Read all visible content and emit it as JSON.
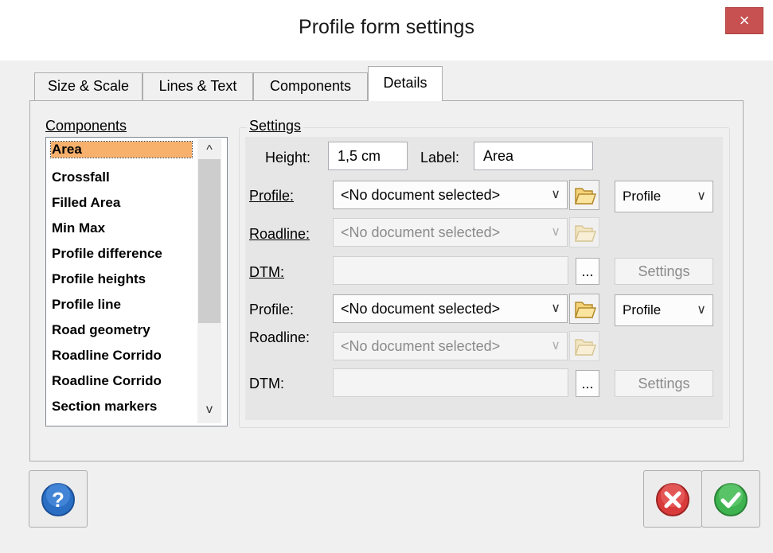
{
  "window": {
    "title": "Profile form settings",
    "close_glyph": "×"
  },
  "tabs": [
    {
      "label": "Size & Scale",
      "active": false
    },
    {
      "label": "Lines & Text",
      "active": false
    },
    {
      "label": "Components",
      "active": false
    },
    {
      "label": "Details",
      "active": true
    }
  ],
  "components": {
    "label": "Components",
    "items": [
      "Area",
      "Crossfall",
      "Filled Area",
      "Min Max",
      "Profile difference",
      "Profile heights",
      "Profile line",
      "Road geometry",
      "Roadline Corrido",
      "Roadline Corrido",
      "Section markers"
    ],
    "selected": "Area",
    "scroll_up_glyph": "^",
    "scroll_down_glyph": "v"
  },
  "settings": {
    "label": "Settings",
    "height_label": "Height:",
    "height_value": "1,5 cm",
    "label_label": "Label:",
    "label_value": "Area",
    "group1": {
      "profile_label": "Profile:",
      "profile_value": "<No document selected>",
      "profile_type": "Profile",
      "roadline_label": "Roadline:",
      "roadline_value": "<No document selected>",
      "dtm_label": "DTM:",
      "dtm_value": "",
      "ellipsis": "...",
      "settings_button": "Settings"
    },
    "group2": {
      "profile_label": "Profile:",
      "profile_value": "<No document selected>",
      "profile_type": "Profile",
      "roadline_label": "Roadline:",
      "roadline_value": "<No document selected>",
      "dtm_label": "DTM:",
      "dtm_value": "",
      "ellipsis": "...",
      "settings_button": "Settings"
    }
  },
  "icons": {
    "help": "help-icon",
    "cancel": "cancel-icon",
    "ok": "ok-icon",
    "folder": "folder-icon"
  },
  "colors": {
    "selection": "#f7b16d",
    "close_button": "#c75050",
    "help_blue": "#2b6fc4",
    "cancel_red": "#d93b3b",
    "ok_green": "#3fb34f"
  }
}
